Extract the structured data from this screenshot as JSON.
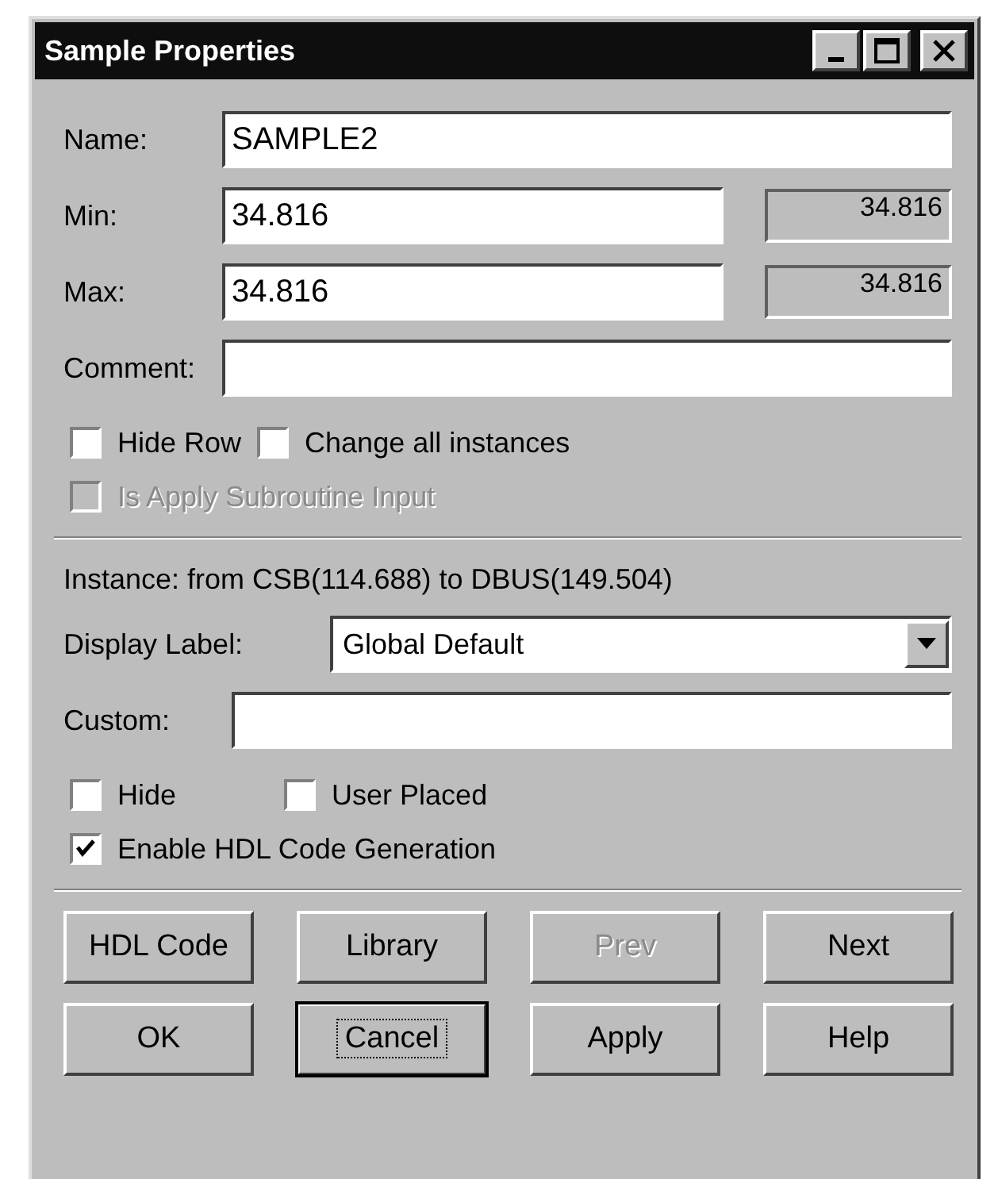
{
  "window": {
    "title": "Sample Properties",
    "controls": [
      {
        "kind": "minimize"
      },
      {
        "kind": "maximize"
      },
      {
        "kind": "close"
      }
    ]
  },
  "fields": [
    {
      "label": "Name:",
      "value": "SAMPLE2"
    },
    {
      "label": "Min:",
      "value": "34.816",
      "readout": "34.816"
    },
    {
      "label": "Max:",
      "value": "34.816",
      "readout": "34.816"
    },
    {
      "label": "Comment:"
    }
  ],
  "options_top": [
    {
      "label": "Hide Row",
      "checked": false,
      "disabled": false
    },
    {
      "label": "Change all instances",
      "checked": false,
      "disabled": false
    }
  ],
  "option_subroutine": {
    "label": "Is Apply Subroutine Input",
    "checked": false,
    "disabled": true
  },
  "instance": "Instance: from CSB(114.688) to DBUS(149.504)",
  "display_label": {
    "label": "Display Label:",
    "value": "Global Default"
  },
  "custom": {
    "label": "Custom:"
  },
  "options_bottom": [
    {
      "label": "Hide",
      "checked": false,
      "disabled": false
    },
    {
      "label": "User Placed",
      "checked": false,
      "disabled": false
    }
  ],
  "option_hdl": {
    "label": "Enable HDL Code Generation",
    "checked": true,
    "disabled": false
  },
  "buttons": [
    {
      "label": "HDL Code",
      "disabled": false,
      "default": false
    },
    {
      "label": "Library",
      "disabled": false,
      "default": false
    },
    {
      "label": "Prev",
      "disabled": true,
      "default": false
    },
    {
      "label": "Next",
      "disabled": false,
      "default": false
    },
    {
      "label": "OK",
      "disabled": false,
      "default": false
    },
    {
      "label": "Cancel",
      "disabled": false,
      "default": true
    },
    {
      "label": "Apply",
      "disabled": false,
      "default": false
    },
    {
      "label": "Help",
      "disabled": false,
      "default": false
    }
  ]
}
